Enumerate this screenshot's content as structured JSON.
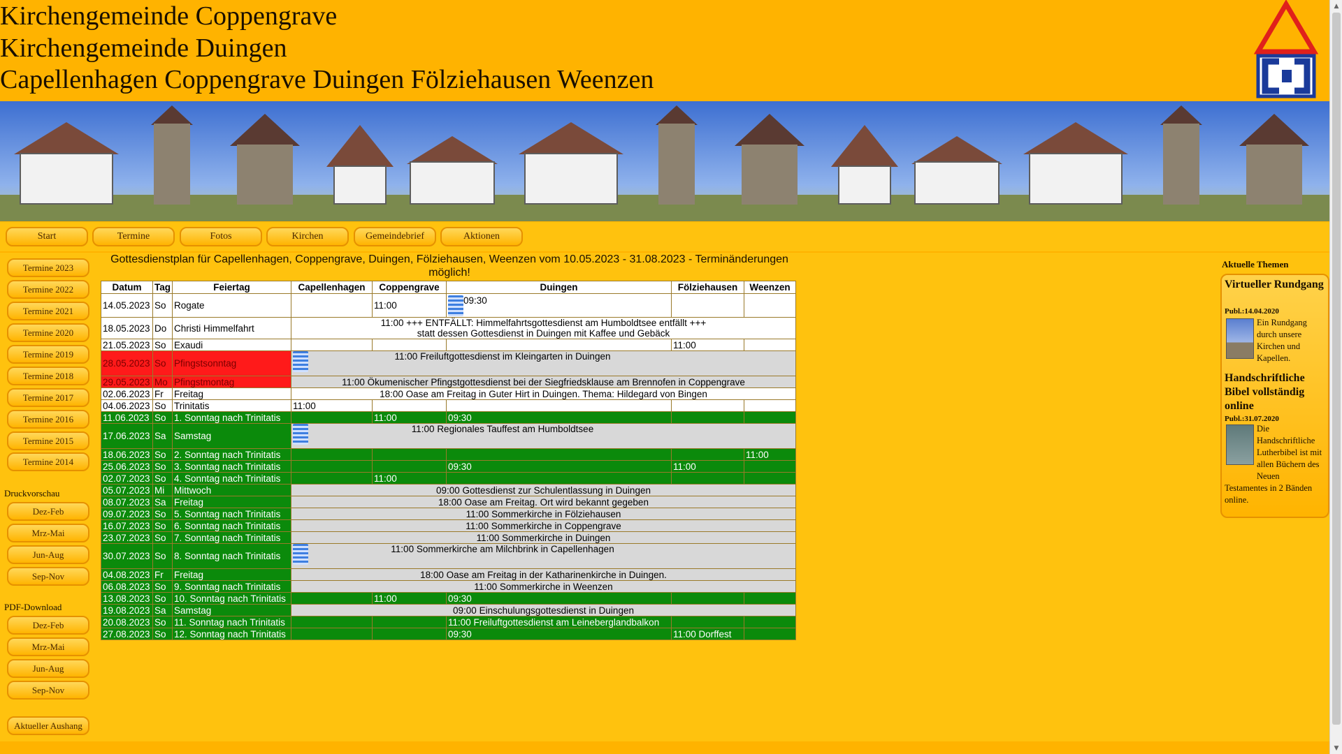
{
  "header": {
    "title_line1": "Kirchengemeinde Coppengrave",
    "title_line2": "Kirchengemeinde Duingen",
    "title_line3": "Capellenhagen Coppengrave Duingen Fölziehausen Weenzen",
    "logo_icon": "church-logo-icon"
  },
  "nav": [
    "Start",
    "Termine",
    "Fotos",
    "Kirchen",
    "Gemeindebrief",
    "Aktionen"
  ],
  "sidebar": {
    "termine": [
      "Termine 2023",
      "Termine 2022",
      "Termine 2021",
      "Termine 2020",
      "Termine 2019",
      "Termine 2018",
      "Termine 2017",
      "Termine 2016",
      "Termine 2015",
      "Termine 2014"
    ],
    "druck_head": "Druckvorschau",
    "druck": [
      "Dez-Feb",
      "Mrz-Mai",
      "Jun-Aug",
      "Sep-Nov"
    ],
    "pdf_head": "PDF-Download",
    "pdf": [
      "Dez-Feb",
      "Mrz-Mai",
      "Jun-Aug",
      "Sep-Nov"
    ],
    "aushang": "Aktueller Aushang"
  },
  "plan": {
    "heading": "Gottesdienstplan für Capellenhagen, Coppengrave, Duingen, Fölziehausen, Weenzen vom 10.05.2023 - 31.08.2023 - Terminänderungen möglich!",
    "columns": [
      "Datum",
      "Tag",
      "Feiertag",
      "Capellenhagen",
      "Coppengrave",
      "Duingen",
      "Fölziehausen",
      "Weenzen"
    ],
    "rows": [
      {
        "d": "14.05.2023",
        "t": "So",
        "f": "Rogate",
        "type": "cells",
        "style": "w",
        "cells": [
          "",
          "11:00",
          "09:30",
          "",
          ""
        ],
        "fish": 2
      },
      {
        "d": "18.05.2023",
        "t": "Do",
        "f": "Christi Himmelfahrt",
        "type": "span",
        "style": "w",
        "text": "11:00 +++ ENTFÄLLT: Himmelfahrtsgottesdienst am Humboldtsee entfällt +++",
        "text2": "statt dessen Gottesdienst in Duingen mit Kaffee und Gebäck"
      },
      {
        "d": "21.05.2023",
        "t": "So",
        "f": "Exaudi",
        "type": "cells",
        "style": "w",
        "cells": [
          "",
          "",
          "",
          "11:00",
          ""
        ]
      },
      {
        "d": "28.05.2023",
        "t": "So",
        "f": "Pfingstsonntag",
        "type": "spanfish",
        "style": "r",
        "text": "11:00 Freiluftgottesdienst im Kleingarten in Duingen"
      },
      {
        "d": "29.05.2023",
        "t": "Mo",
        "f": "Pfingstmontag",
        "type": "span",
        "style": "r",
        "text": "11:00 Ökumenischer Pfingstgottesdienst bei der Siegfriedsklause am Brennofen in Coppengrave"
      },
      {
        "d": "02.06.2023",
        "t": "Fr",
        "f": "Freitag",
        "type": "span",
        "style": "w",
        "text": "18:00 Oase am Freitag in Guter Hirt in Duingen. Thema: Hildegard von Bingen"
      },
      {
        "d": "04.06.2023",
        "t": "So",
        "f": "Trinitatis",
        "type": "cells",
        "style": "w",
        "cells": [
          "11:00",
          "",
          "",
          "",
          ""
        ]
      },
      {
        "d": "11.06.2023",
        "t": "So",
        "f": "1. Sonntag nach Trinitatis",
        "type": "cells",
        "style": "g",
        "cells": [
          "",
          "11:00",
          "09:30",
          "",
          ""
        ]
      },
      {
        "d": "17.06.2023",
        "t": "Sa",
        "f": "Samstag",
        "type": "spanfish",
        "style": "g",
        "text": "11:00 Regionales Tauffest am Humboldtsee"
      },
      {
        "d": "18.06.2023",
        "t": "So",
        "f": "2. Sonntag nach Trinitatis",
        "type": "cells",
        "style": "g",
        "cells": [
          "",
          "",
          "",
          "",
          "11:00"
        ]
      },
      {
        "d": "25.06.2023",
        "t": "So",
        "f": "3. Sonntag nach Trinitatis",
        "type": "cells",
        "style": "g",
        "cells": [
          "",
          "",
          "09:30",
          "11:00",
          ""
        ]
      },
      {
        "d": "02.07.2023",
        "t": "So",
        "f": "4. Sonntag nach Trinitatis",
        "type": "cells",
        "style": "g",
        "cells": [
          "",
          "11:00",
          "",
          "",
          ""
        ]
      },
      {
        "d": "05.07.2023",
        "t": "Mi",
        "f": "Mittwoch",
        "type": "span",
        "style": "g",
        "text": "09:00 Gottesdienst zur Schulentlassung in Duingen"
      },
      {
        "d": "08.07.2023",
        "t": "Sa",
        "f": "Freitag",
        "type": "span",
        "style": "g",
        "text": "18:00 Oase am Freitag. Ort wird bekannt gegeben"
      },
      {
        "d": "09.07.2023",
        "t": "So",
        "f": "5. Sonntag nach Trinitatis",
        "type": "span",
        "style": "g",
        "text": "11:00 Sommerkirche in Fölziehausen"
      },
      {
        "d": "16.07.2023",
        "t": "So",
        "f": "6. Sonntag nach Trinitatis",
        "type": "span",
        "style": "g",
        "text": "11:00 Sommerkirche in Coppengrave"
      },
      {
        "d": "23.07.2023",
        "t": "So",
        "f": "7. Sonntag nach Trinitatis",
        "type": "span",
        "style": "g",
        "text": "11:00 Sommerkirche in Duingen"
      },
      {
        "d": "30.07.2023",
        "t": "So",
        "f": "8. Sonntag nach Trinitatis",
        "type": "spanfish",
        "style": "g",
        "text": "11:00 Sommerkirche am Milchbrink in Capellenhagen"
      },
      {
        "d": "04.08.2023",
        "t": "Fr",
        "f": "Freitag",
        "type": "span",
        "style": "g",
        "text": "18:00 Oase am Freitag in der Katharinenkirche in Duingen."
      },
      {
        "d": "06.08.2023",
        "t": "So",
        "f": "9. Sonntag nach Trinitatis",
        "type": "span",
        "style": "g",
        "text": "11:00 Sommerkirche in Weenzen"
      },
      {
        "d": "13.08.2023",
        "t": "So",
        "f": "10. Sonntag nach Trinitatis",
        "type": "cells",
        "style": "g",
        "cells": [
          "",
          "11:00",
          "09:30",
          "",
          ""
        ]
      },
      {
        "d": "19.08.2023",
        "t": "Sa",
        "f": "Samstag",
        "type": "span",
        "style": "g",
        "text": "09:00 Einschulungsgottesdienst in Duingen"
      },
      {
        "d": "20.08.2023",
        "t": "So",
        "f": "11. Sonntag nach Trinitatis",
        "type": "cells",
        "style": "g",
        "cells": [
          "",
          "",
          "11:00 Freiluftgottesdienst am Leinebergland­balkon",
          "",
          ""
        ]
      },
      {
        "d": "27.08.2023",
        "t": "So",
        "f": "12. Sonntag nach Trinitatis",
        "type": "cells",
        "style": "g",
        "cells": [
          "",
          "",
          "09:30",
          "11:00 Dorffest",
          ""
        ]
      }
    ]
  },
  "right": {
    "head": "Aktuelle Themen",
    "news1_title": "Virtueller Rundgang",
    "news1_date": "Publ.:14.04.2020",
    "news1_text": "Ein Rundgang durch unsere Kirchen und Kapellen.",
    "news2_title": "Handschriftliche Bibel vollständig online",
    "news2_date": "Publ.:31.07.2020",
    "news2_text_side": "Die Handschriftliche Lutherbibel ist mit allen Büchern des Neuen",
    "news2_text_full": "Testamentes in 2 Bänden online."
  },
  "colors": {
    "accent": "#ffb300",
    "green": "#0b8a0b",
    "red": "#ff1a1a",
    "logo_red": "#e0201b",
    "logo_blue": "#1a3a9a"
  }
}
